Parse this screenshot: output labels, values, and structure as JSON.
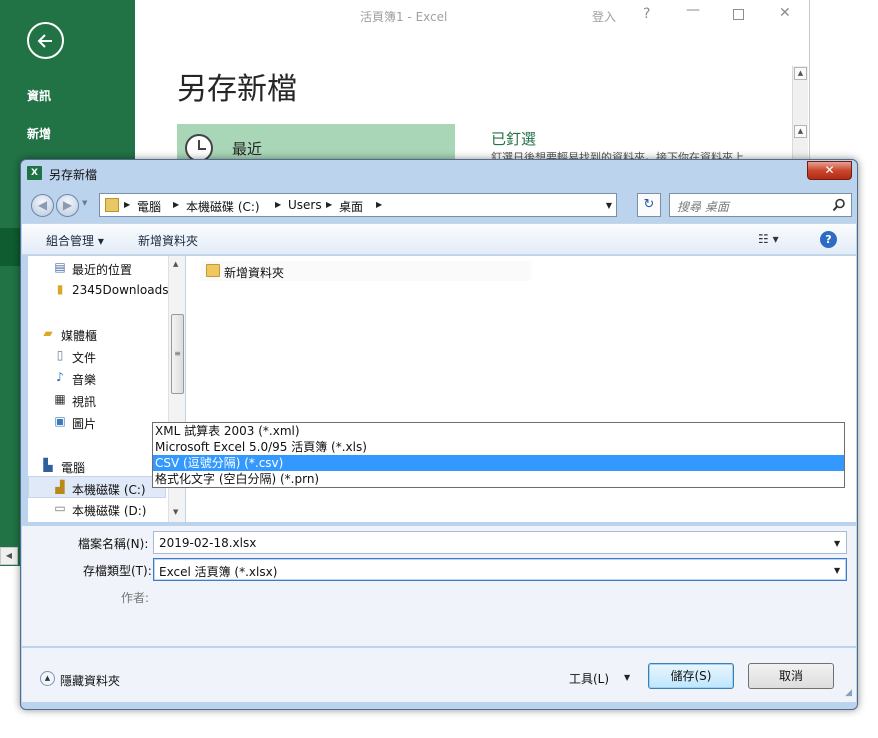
{
  "excel": {
    "title": "活頁簿1 - Excel",
    "sign_in": "登入",
    "help": "?",
    "minimize": "—",
    "close": "✕",
    "nav": {
      "info": "資訊",
      "new": "新增"
    },
    "heading": "另存新檔",
    "recent": "最近",
    "pinned_heading": "已釘選",
    "pinned_text": "釘選日後想要輕易找到的資料夾。接下你在資料夾上"
  },
  "dialog": {
    "icon_text": "X",
    "title": "另存新檔",
    "close": "✕",
    "address": {
      "breadcrumbs": [
        "電腦",
        "本機磁碟 (C:)",
        "Users",
        "桌面"
      ]
    },
    "search": {
      "placeholder": "搜尋 桌面"
    },
    "toolbar": {
      "organize": "組合管理 ▾",
      "new_folder": "新增資料夾",
      "view": "☷ ▾",
      "help": "?"
    },
    "tree": [
      {
        "label": "最近的位置",
        "icon": "recent-places-icon"
      },
      {
        "label": "2345Downloads",
        "icon": "folder-icon"
      },
      {
        "label": "媒體櫃",
        "icon": "libraries-icon"
      },
      {
        "label": "文件",
        "icon": "documents-icon"
      },
      {
        "label": "音樂",
        "icon": "music-icon"
      },
      {
        "label": "視訊",
        "icon": "video-icon"
      },
      {
        "label": "圖片",
        "icon": "pictures-icon"
      },
      {
        "label": "電腦",
        "icon": "computer-icon"
      },
      {
        "label": "本機磁碟 (C:)",
        "icon": "local-disk-icon"
      },
      {
        "label": "本機磁碟 (D:)",
        "icon": "drive-icon"
      }
    ],
    "files": [
      {
        "name": "新增資料夾",
        "icon": "folder-icon"
      }
    ],
    "fields": {
      "filename_label": "檔案名稱(N):",
      "filename_value": "2019-02-18.xlsx",
      "filetype_label": "存檔類型(T):",
      "filetype_value": "Excel 活頁簿 (*.xlsx)",
      "author_label": "作者:"
    },
    "dropdown_options": [
      "XML 試算表 2003 (*.xml)",
      "Microsoft Excel 5.0/95 活頁簿 (*.xls)",
      "CSV (逗號分隔) (*.csv)",
      "格式化文字 (空白分隔) (*.prn)"
    ],
    "dropdown_selected_index": 2,
    "bottom": {
      "hide_folders": "隱藏資料夾",
      "tools": "工具(L)",
      "save": "儲存(S)",
      "cancel": "取消"
    }
  },
  "colors": {
    "excel_green": "#217346",
    "selection_blue": "#3399ff",
    "dialog_frame": "#bcd3ee"
  }
}
